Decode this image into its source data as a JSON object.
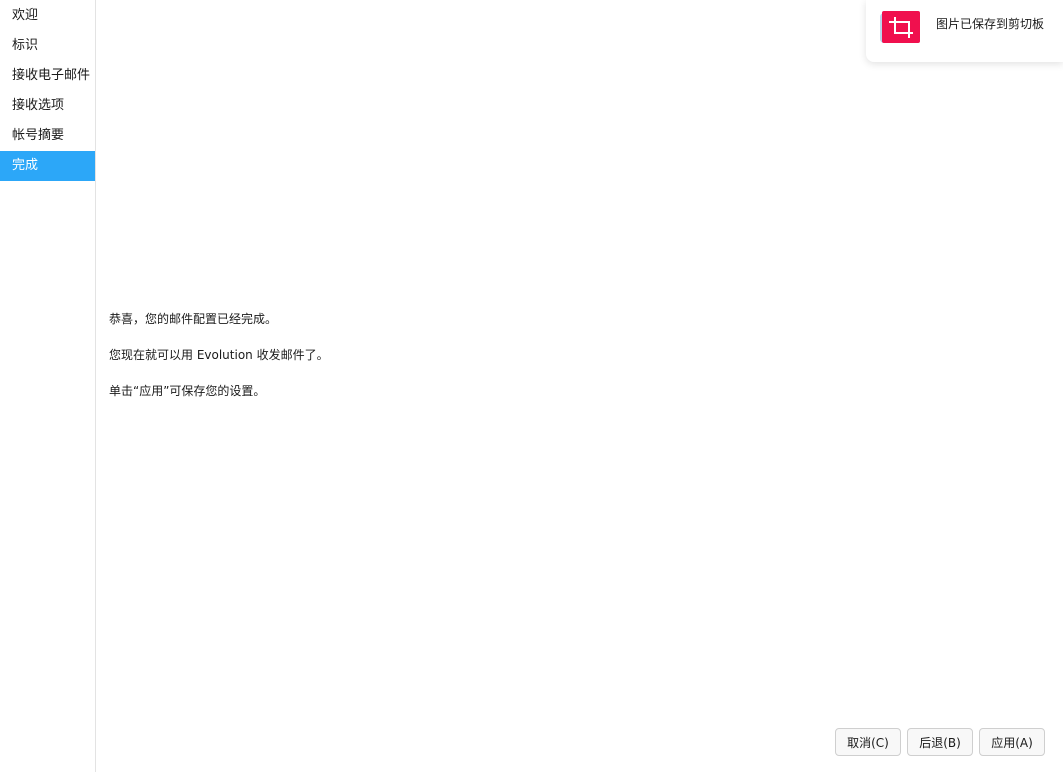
{
  "sidebar": {
    "items": [
      {
        "label": "欢迎"
      },
      {
        "label": "标识"
      },
      {
        "label": "接收电子邮件"
      },
      {
        "label": "接收选项"
      },
      {
        "label": "帐号摘要"
      },
      {
        "label": "完成"
      }
    ],
    "active_index": 5
  },
  "main": {
    "message_lines": [
      "恭喜，您的邮件配置已经完成。",
      "您现在就可以用 Evolution 收发邮件了。",
      "单击“应用”可保存您的设置。"
    ]
  },
  "buttons": {
    "cancel": "取消(C)",
    "back": "后退(B)",
    "apply": "应用(A)"
  },
  "toast": {
    "text": "图片已保存到剪切板",
    "icon": "crop-icon",
    "icon_color": "#f0104e"
  },
  "colors": {
    "accent": "#2ca7f8"
  }
}
